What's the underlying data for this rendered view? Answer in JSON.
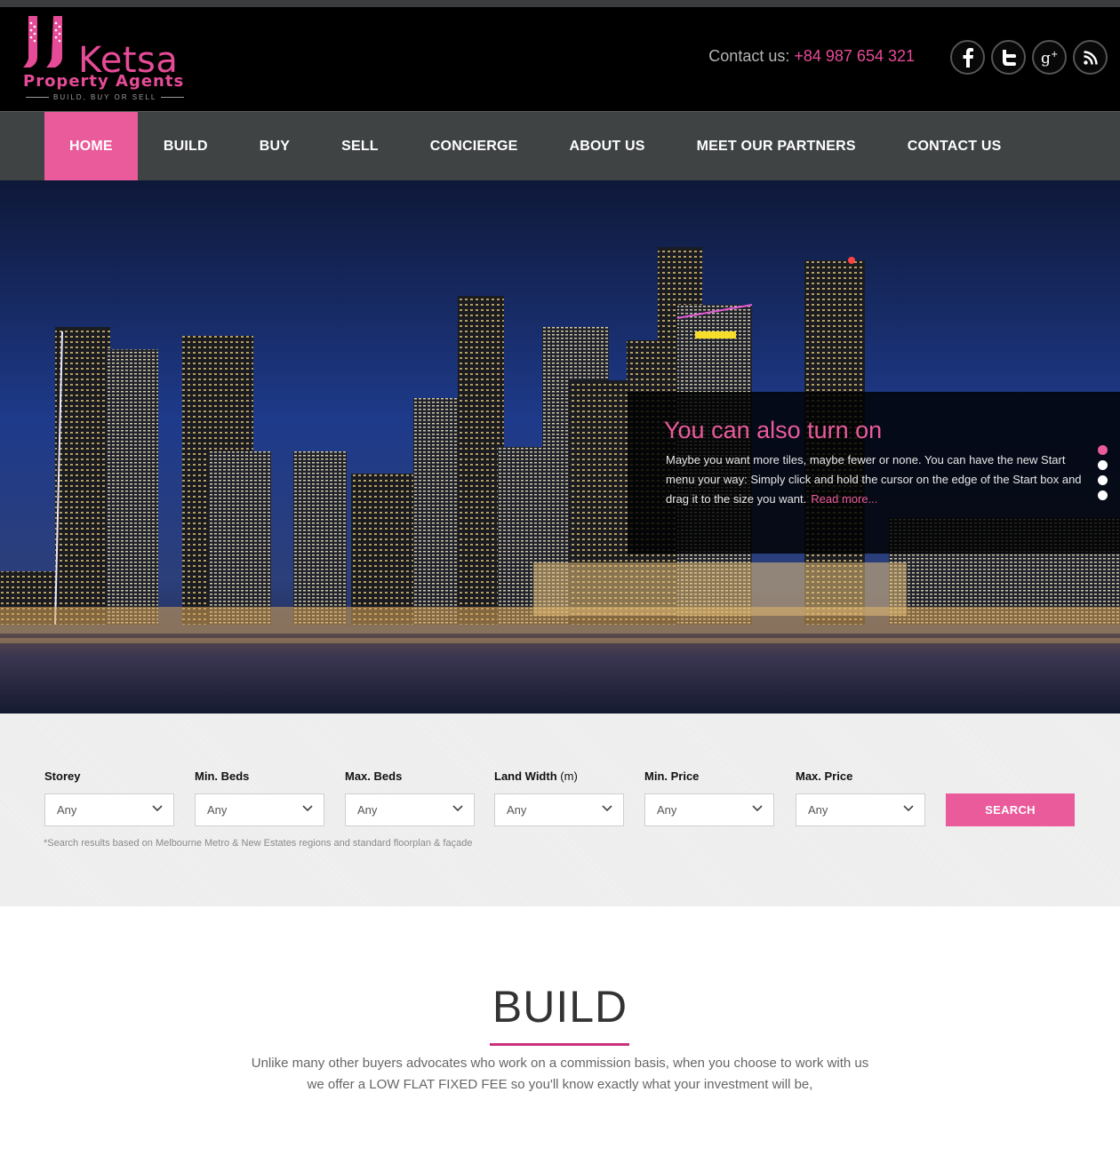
{
  "brand": {
    "name": "Ketsa",
    "subtitle": "Property Agents",
    "tagline": "BUILD, BUY OR SELL",
    "accent_color": "#ea5b9c"
  },
  "header": {
    "contact_label": "Contact us:",
    "contact_phone": "+84 987 654 321",
    "socials": [
      {
        "icon": "facebook-icon"
      },
      {
        "icon": "twitter-icon"
      },
      {
        "icon": "google-plus-icon"
      },
      {
        "icon": "rss-icon"
      }
    ]
  },
  "nav": {
    "items": [
      {
        "label": "HOME",
        "active": true
      },
      {
        "label": "BUILD"
      },
      {
        "label": "BUY"
      },
      {
        "label": "SELL"
      },
      {
        "label": "CONCIERGE"
      },
      {
        "label": "ABOUT US"
      },
      {
        "label": "MEET OUR PARTNERS"
      },
      {
        "label": "CONTACT US"
      }
    ]
  },
  "hero": {
    "caption_title": "You can also turn on",
    "caption_text": "Maybe you want more tiles, maybe fewer or none. You can have the new Start menu your way: Simply click and hold the cursor on the edge of the Start box and drag it to the size you want.",
    "read_more": "Read more...",
    "slide_count": 4,
    "active_slide": 1
  },
  "search": {
    "fields": [
      {
        "label": "Storey",
        "value": "Any"
      },
      {
        "label": "Min. Beds",
        "value": "Any"
      },
      {
        "label": "Max. Beds",
        "value": "Any"
      },
      {
        "label": "Land Width",
        "unit": "(m)",
        "value": "Any"
      },
      {
        "label": "Min. Price",
        "value": "Any"
      },
      {
        "label": "Max. Price",
        "value": "Any"
      }
    ],
    "button_label": "SEARCH",
    "note": "*Search results based on Melbourne Metro & New Estates regions and standard floorplan & façade"
  },
  "build": {
    "title": "BUILD",
    "text": "Unlike many other buyers advocates who work on a commission basis, when you choose to work with us we offer a LOW FLAT FIXED FEE so you'll know exactly what your investment will be,"
  }
}
